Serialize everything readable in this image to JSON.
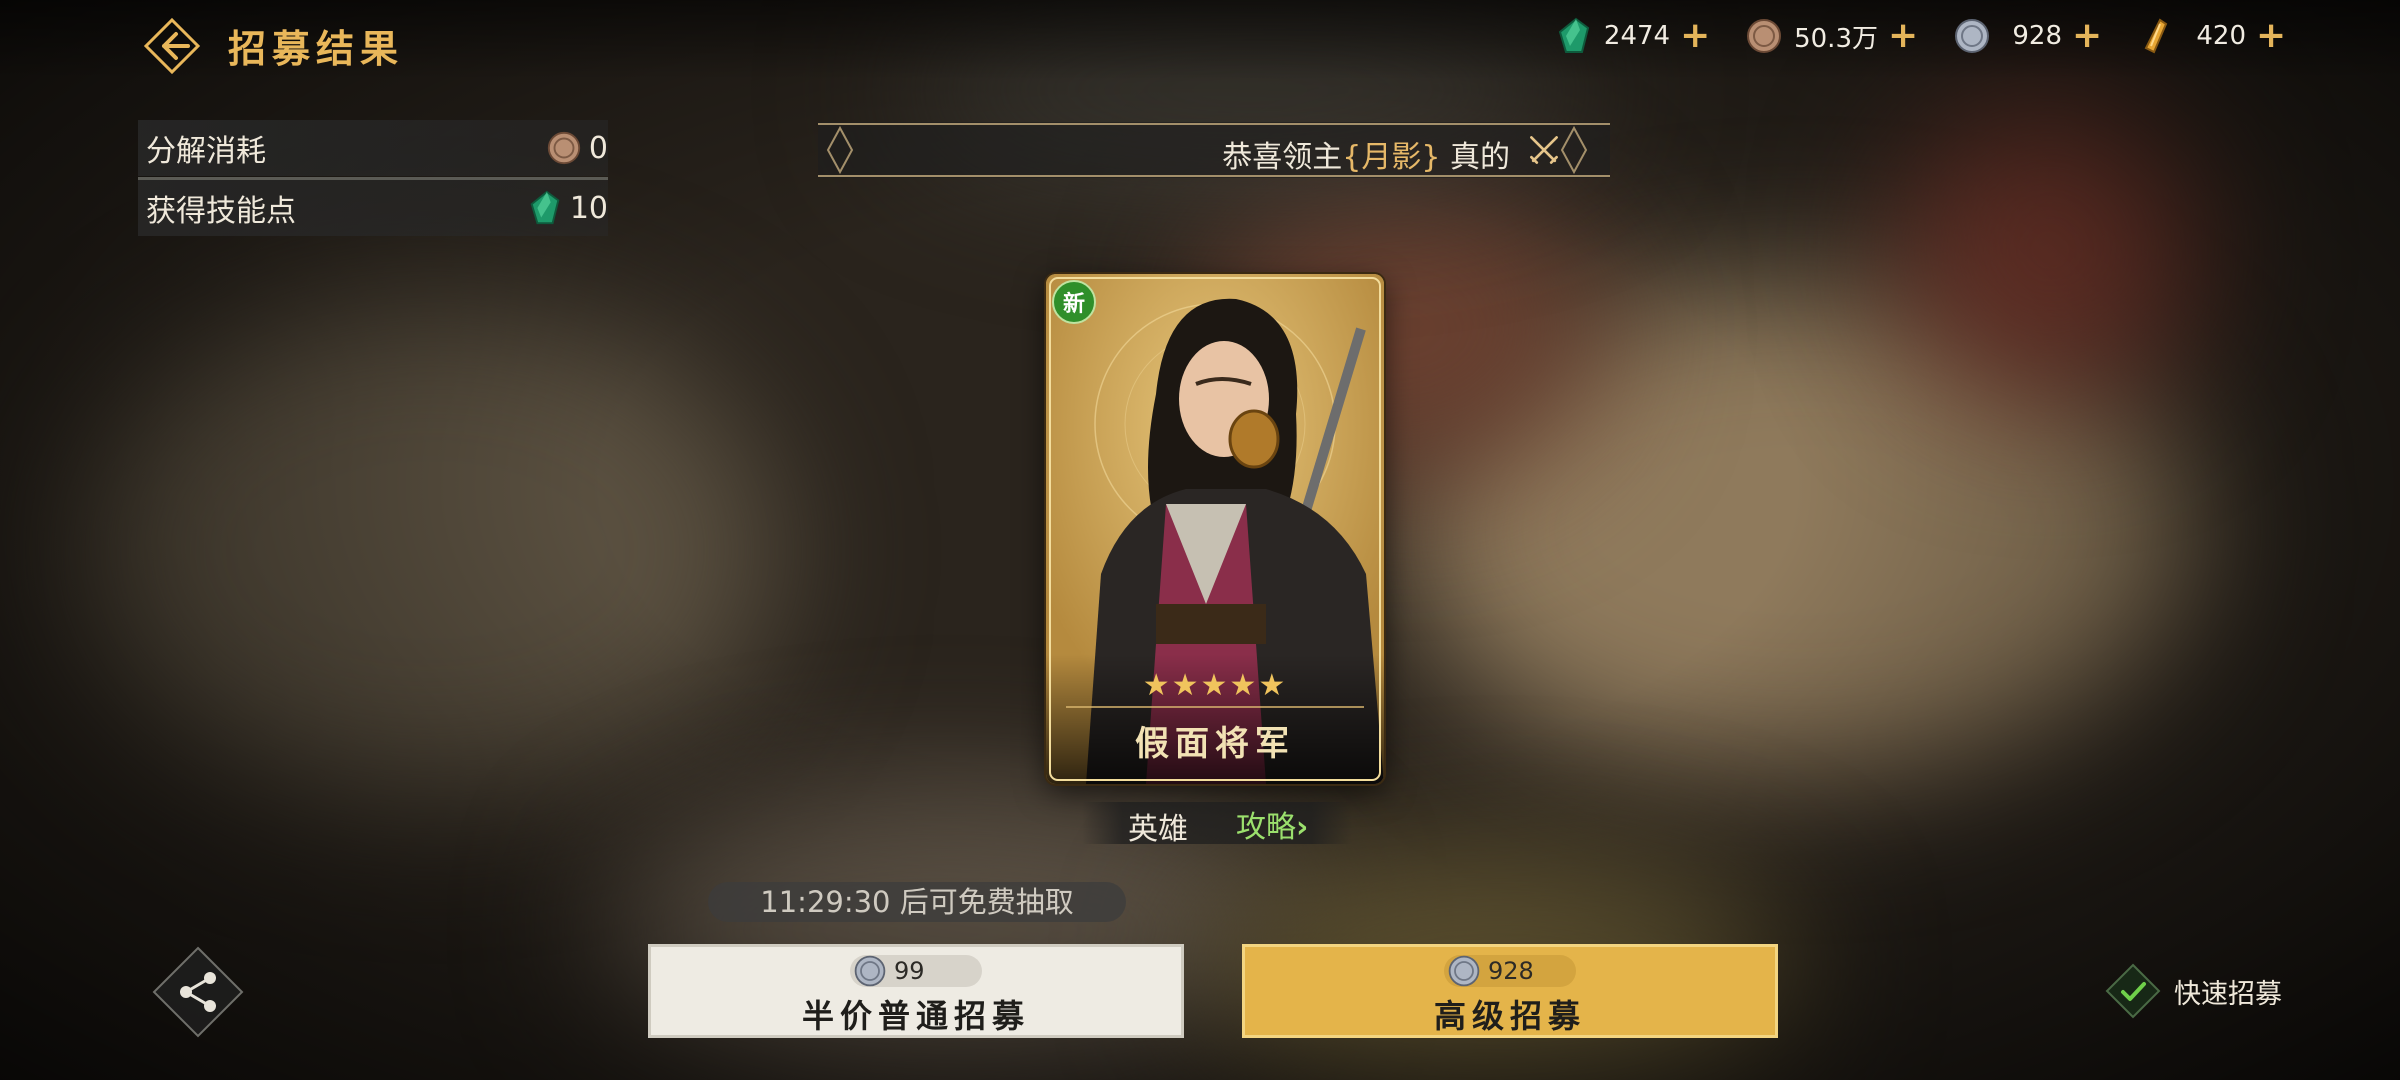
{
  "header": {
    "title": "招募结果",
    "back_icon": "back-arrow-icon"
  },
  "currencies": [
    {
      "name": "jade",
      "icon": "jade-gem-icon",
      "value": "2474",
      "plus": "+"
    },
    {
      "name": "copper",
      "icon": "copper-coin-icon",
      "value": "50.3万",
      "plus": "+"
    },
    {
      "name": "silver",
      "icon": "silver-coin-icon",
      "value": "928",
      "plus": "+"
    },
    {
      "name": "gold",
      "icon": "gold-bar-icon",
      "value": "420",
      "plus": "+"
    }
  ],
  "info": {
    "decompose_label": "分解消耗",
    "decompose_value": "0",
    "skillpoint_label": "获得技能点",
    "skillpoint_value": "10"
  },
  "banner": {
    "prefix": "恭喜领主",
    "name": "{月影}",
    "suffix": "真的"
  },
  "hero": {
    "new_badge": "新",
    "stars": "★★★★★",
    "star_count": 5,
    "name": "假面将军",
    "type": "英雄",
    "guide": "攻略",
    "guide_chevron": "›"
  },
  "timer": "11:29:30 后可免费抽取",
  "buttons": {
    "normal": {
      "cost": "99",
      "label": "半价普通招募"
    },
    "advanced": {
      "cost": "928",
      "label": "高级招募"
    }
  },
  "quick_recruit": {
    "label": "快速招募",
    "checked": true
  },
  "colors": {
    "accent": "#e9b75a",
    "link": "#9be06d",
    "advanced_button": "#e4b44a"
  }
}
